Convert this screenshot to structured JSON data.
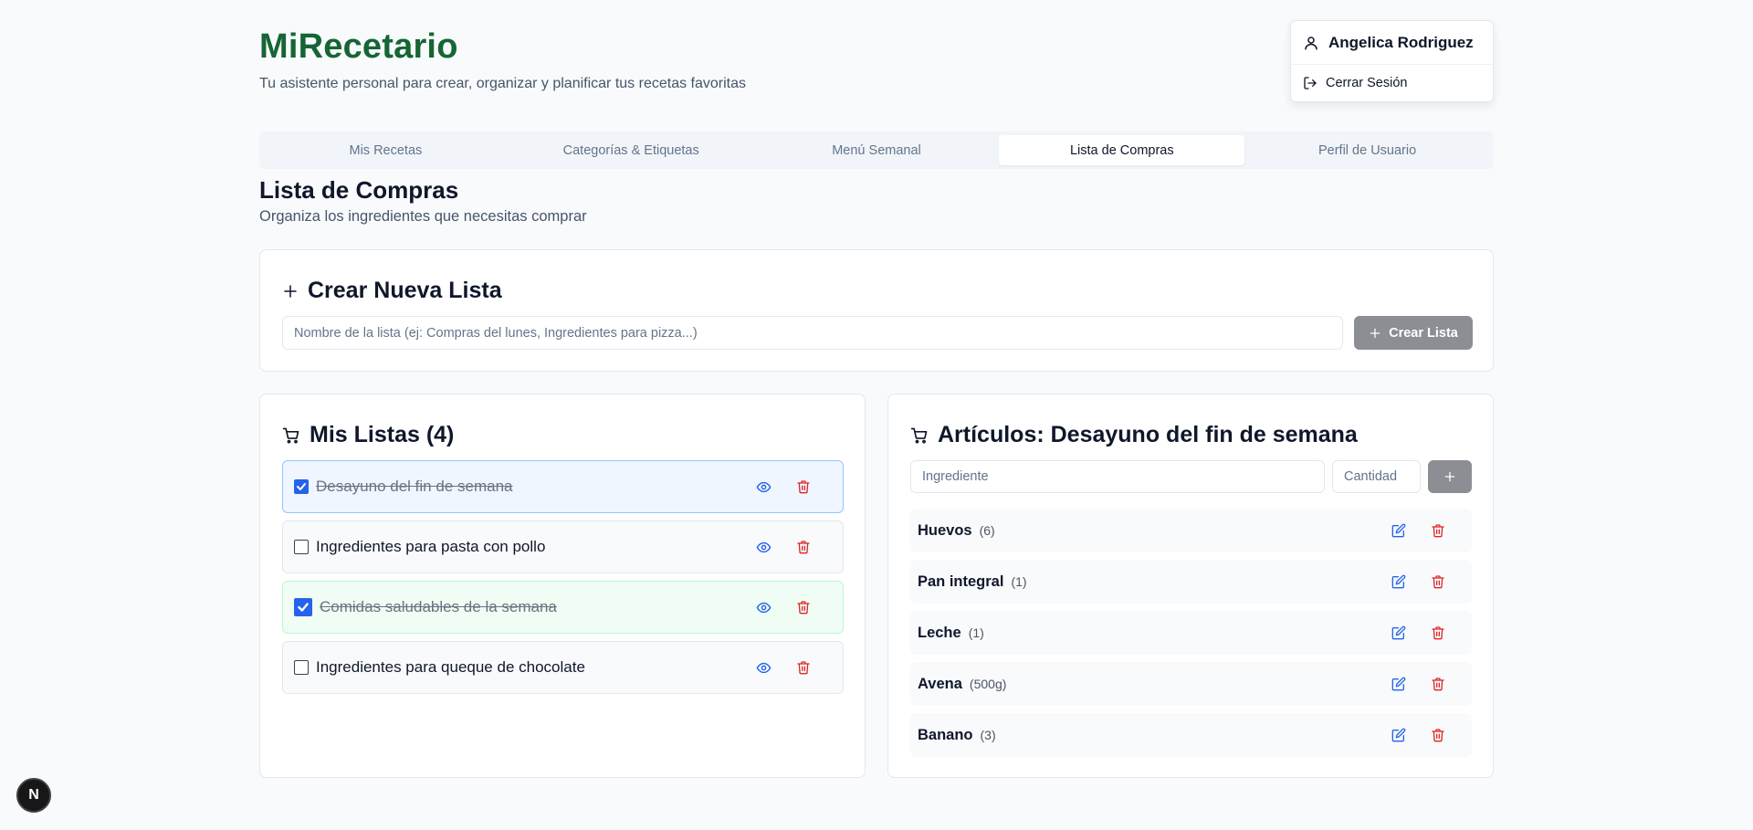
{
  "header": {
    "title": "MiRecetario",
    "subtitle": "Tu asistente personal para crear, organizar y planificar tus recetas favoritas"
  },
  "user_menu": {
    "name": "Angelica Rodriguez",
    "logout_label": "Cerrar Sesión"
  },
  "tabs": [
    {
      "label": "Mis Recetas",
      "active": false
    },
    {
      "label": "Categorías & Etiquetas",
      "active": false
    },
    {
      "label": "Menú Semanal",
      "active": false
    },
    {
      "label": "Lista de Compras",
      "active": true
    },
    {
      "label": "Perfil de Usuario",
      "active": false
    }
  ],
  "page": {
    "title": "Lista de Compras",
    "subtitle": "Organiza los ingredientes que necesitas comprar"
  },
  "create_list": {
    "title": "Crear Nueva Lista",
    "input_placeholder": "Nombre de la lista (ej: Compras del lunes, Ingredientes para pizza...)",
    "button_label": "Crear Lista"
  },
  "my_lists": {
    "title": "Mis Listas (4)",
    "items": [
      {
        "name": "Desayuno del fin de semana",
        "checked": true,
        "selected": true
      },
      {
        "name": "Ingredientes para pasta con pollo",
        "checked": false,
        "selected": false
      },
      {
        "name": "Comidas saludables de la semana",
        "checked": true,
        "selected": false
      },
      {
        "name": "Ingredientes para queque de chocolate",
        "checked": false,
        "selected": false
      }
    ]
  },
  "articles": {
    "title": "Artículos: Desayuno del fin de semana",
    "ingredient_placeholder": "Ingrediente",
    "quantity_placeholder": "Cantidad",
    "items": [
      {
        "name": "Huevos",
        "qty": "(6)"
      },
      {
        "name": "Pan integral",
        "qty": "(1)"
      },
      {
        "name": "Leche",
        "qty": "(1)"
      },
      {
        "name": "Avena",
        "qty": "(500g)"
      },
      {
        "name": "Banano",
        "qty": "(3)"
      }
    ]
  },
  "badge": {
    "label": "N"
  },
  "colors": {
    "brand": "#166534",
    "accent_blue": "#2563eb",
    "danger": "#dc2626",
    "disabled_button": "#8b8f94"
  }
}
